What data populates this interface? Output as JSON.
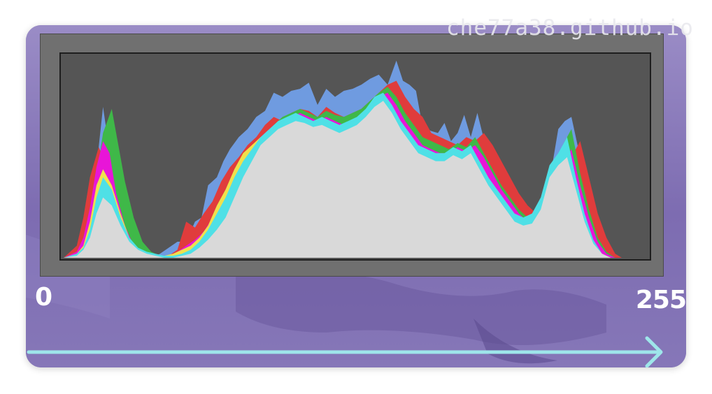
{
  "watermark": "che77a38.github.io",
  "axis": {
    "min_label": "0",
    "max_label": "255"
  },
  "colors": {
    "card_background": "#8272b4",
    "frame": "#707070",
    "plot_background": "#555555",
    "arrow": "#9ee6ea"
  },
  "chart_data": {
    "type": "area",
    "title": "",
    "xlabel": "",
    "ylabel": "",
    "xlim": [
      0,
      255
    ],
    "ylim": [
      0,
      100
    ],
    "grid": false,
    "legend": "none",
    "series": [
      {
        "color": "#6f9be0",
        "x": [
          0,
          6,
          9,
          13,
          16,
          18,
          20,
          22,
          24,
          27,
          30,
          33,
          36,
          40,
          44,
          48,
          52,
          56,
          60,
          63,
          66,
          70,
          73,
          76,
          80,
          84,
          88,
          92,
          96,
          100,
          104,
          108,
          112,
          116,
          120,
          124,
          128,
          132,
          136,
          140,
          144,
          148,
          152,
          155,
          158,
          161,
          164,
          168,
          171,
          174,
          177,
          180,
          183,
          186,
          189,
          192,
          195,
          198,
          202,
          206,
          210,
          214,
          218,
          222,
          226,
          229,
          232,
          235,
          238,
          241,
          244,
          247,
          250,
          253,
          255
        ],
        "y": [
          0,
          2,
          4,
          24,
          55,
          75,
          60,
          40,
          25,
          13,
          6,
          2,
          1,
          0,
          2,
          5,
          8,
          8,
          18,
          20,
          36,
          40,
          48,
          54,
          60,
          64,
          70,
          73,
          82,
          80,
          83,
          84,
          87,
          76,
          84,
          80,
          83,
          84,
          86,
          89,
          91,
          86,
          98,
          88,
          86,
          83,
          65,
          63,
          62,
          67,
          58,
          62,
          71,
          60,
          72,
          59,
          49,
          36,
          30,
          25,
          22,
          20,
          28,
          38,
          64,
          68,
          70,
          55,
          35,
          23,
          18,
          10,
          3,
          0,
          0
        ]
      },
      {
        "color": "#e03c3c",
        "x": [
          0,
          6,
          9,
          12,
          16,
          20,
          24,
          28,
          32,
          36,
          40,
          44,
          48,
          52,
          56,
          60,
          64,
          68,
          72,
          76,
          80,
          84,
          88,
          92,
          96,
          100,
          104,
          108,
          112,
          116,
          120,
          124,
          128,
          132,
          136,
          140,
          144,
          148,
          152,
          156,
          160,
          164,
          168,
          172,
          176,
          180,
          184,
          188,
          192,
          196,
          200,
          204,
          208,
          212,
          216,
          220,
          224,
          228,
          232,
          236,
          240,
          244,
          248,
          252,
          255
        ],
        "y": [
          0,
          6,
          20,
          40,
          55,
          45,
          30,
          15,
          6,
          2,
          1,
          0,
          1,
          4,
          18,
          15,
          22,
          28,
          38,
          45,
          50,
          56,
          60,
          66,
          70,
          68,
          72,
          74,
          73,
          70,
          75,
          72,
          70,
          72,
          74,
          78,
          82,
          86,
          88,
          80,
          74,
          70,
          62,
          60,
          58,
          56,
          60,
          58,
          62,
          56,
          48,
          40,
          32,
          26,
          22,
          20,
          22,
          30,
          50,
          58,
          40,
          22,
          10,
          2,
          0
        ]
      },
      {
        "color": "#3fb848",
        "x": [
          0,
          6,
          9,
          12,
          15,
          18,
          22,
          25,
          28,
          32,
          36,
          40,
          44,
          48,
          52,
          56,
          60,
          64,
          68,
          72,
          76,
          80,
          84,
          88,
          92,
          96,
          100,
          104,
          108,
          112,
          116,
          120,
          124,
          128,
          132,
          136,
          140,
          144,
          148,
          152,
          156,
          160,
          164,
          168,
          172,
          176,
          180,
          184,
          188,
          192,
          196,
          200,
          204,
          208,
          212,
          216,
          220,
          224,
          228,
          232,
          236,
          240,
          244,
          248,
          252,
          255
        ],
        "y": [
          0,
          3,
          8,
          20,
          40,
          62,
          74,
          56,
          38,
          20,
          8,
          3,
          1,
          0,
          1,
          3,
          6,
          10,
          14,
          22,
          30,
          40,
          48,
          56,
          62,
          66,
          70,
          72,
          74,
          72,
          70,
          73,
          71,
          70,
          72,
          74,
          78,
          82,
          85,
          80,
          72,
          66,
          60,
          58,
          56,
          54,
          57,
          55,
          60,
          52,
          44,
          36,
          30,
          24,
          20,
          18,
          20,
          30,
          56,
          64,
          42,
          24,
          10,
          3,
          0,
          0
        ]
      },
      {
        "color": "#e815d8",
        "x": [
          0,
          6,
          9,
          12,
          15,
          18,
          21,
          24,
          28,
          32,
          36,
          40,
          44,
          48,
          52,
          56,
          60,
          64,
          68,
          72,
          76,
          80,
          84,
          88,
          92,
          96,
          100,
          104,
          108,
          112,
          116,
          120,
          124,
          128,
          132,
          136,
          140,
          144,
          148,
          152,
          156,
          160,
          164,
          168,
          172,
          176,
          180,
          184,
          188,
          192,
          196,
          200,
          204,
          208,
          212,
          216,
          220,
          224,
          228,
          232,
          236,
          240,
          244,
          248,
          252,
          255
        ],
        "y": [
          0,
          3,
          10,
          25,
          45,
          58,
          52,
          32,
          16,
          6,
          2,
          1,
          0,
          1,
          3,
          6,
          9,
          13,
          20,
          28,
          36,
          44,
          52,
          58,
          62,
          66,
          68,
          70,
          72,
          70,
          68,
          70,
          68,
          66,
          68,
          70,
          74,
          80,
          82,
          76,
          68,
          62,
          56,
          54,
          52,
          52,
          55,
          53,
          56,
          50,
          42,
          34,
          28,
          22,
          18,
          16,
          18,
          26,
          46,
          54,
          36,
          20,
          8,
          2,
          0,
          0
        ]
      },
      {
        "color": "#f0e04c",
        "x": [
          0,
          6,
          9,
          12,
          15,
          18,
          22,
          26,
          30,
          34,
          38,
          42,
          46,
          50,
          54,
          58,
          62,
          66,
          70,
          74,
          78,
          82,
          86,
          90,
          94,
          98,
          102,
          106,
          110,
          114,
          118,
          122,
          126,
          130,
          134,
          138,
          142,
          146,
          150,
          154,
          158,
          162,
          166,
          170,
          174,
          178,
          182,
          186,
          190,
          194,
          198,
          202,
          206,
          210,
          214,
          218,
          222,
          226,
          230,
          234,
          238,
          242,
          246,
          250,
          255
        ],
        "y": [
          0,
          2,
          6,
          18,
          36,
          44,
          36,
          22,
          10,
          4,
          1,
          0,
          1,
          2,
          4,
          6,
          10,
          16,
          26,
          34,
          44,
          52,
          56,
          60,
          62,
          64,
          66,
          68,
          67,
          66,
          68,
          66,
          64,
          66,
          68,
          72,
          78,
          80,
          74,
          66,
          60,
          54,
          52,
          50,
          50,
          53,
          51,
          54,
          48,
          40,
          32,
          26,
          20,
          16,
          14,
          16,
          24,
          44,
          50,
          34,
          18,
          7,
          2,
          0,
          0
        ]
      },
      {
        "color": "#4fe0e6",
        "x": [
          0,
          6,
          9,
          12,
          15,
          18,
          22,
          26,
          30,
          34,
          38,
          42,
          46,
          50,
          54,
          58,
          62,
          66,
          70,
          74,
          78,
          82,
          86,
          90,
          94,
          98,
          102,
          106,
          110,
          114,
          118,
          122,
          126,
          130,
          134,
          138,
          142,
          146,
          150,
          154,
          158,
          162,
          166,
          170,
          174,
          178,
          182,
          186,
          190,
          194,
          198,
          202,
          206,
          210,
          214,
          218,
          222,
          226,
          230,
          234,
          238,
          242,
          246,
          250,
          255
        ],
        "y": [
          0,
          2,
          5,
          14,
          30,
          40,
          34,
          20,
          10,
          5,
          3,
          2,
          1,
          1,
          2,
          4,
          8,
          14,
          22,
          30,
          40,
          48,
          54,
          60,
          64,
          68,
          70,
          72,
          70,
          68,
          70,
          68,
          66,
          68,
          70,
          74,
          80,
          82,
          76,
          68,
          62,
          56,
          54,
          52,
          52,
          55,
          53,
          56,
          48,
          40,
          34,
          28,
          22,
          20,
          22,
          30,
          46,
          52,
          60,
          40,
          22,
          9,
          2,
          0,
          0
        ]
      },
      {
        "color": "#d9d9d9",
        "x": [
          0,
          6,
          9,
          12,
          15,
          18,
          22,
          26,
          30,
          34,
          38,
          42,
          46,
          50,
          54,
          58,
          62,
          66,
          70,
          74,
          78,
          82,
          86,
          90,
          94,
          98,
          102,
          106,
          110,
          114,
          118,
          122,
          126,
          130,
          134,
          138,
          142,
          146,
          150,
          154,
          158,
          162,
          166,
          170,
          174,
          178,
          182,
          186,
          190,
          194,
          198,
          202,
          206,
          210,
          214,
          218,
          222,
          226,
          230,
          234,
          238,
          242,
          246,
          250,
          255
        ],
        "y": [
          0,
          1,
          4,
          10,
          22,
          30,
          26,
          16,
          8,
          4,
          2,
          1,
          0,
          0,
          1,
          2,
          5,
          9,
          14,
          20,
          30,
          40,
          48,
          56,
          60,
          64,
          66,
          68,
          67,
          65,
          66,
          64,
          62,
          64,
          66,
          70,
          75,
          78,
          72,
          64,
          58,
          52,
          50,
          48,
          48,
          51,
          49,
          52,
          44,
          36,
          30,
          24,
          18,
          16,
          17,
          24,
          40,
          46,
          50,
          34,
          18,
          7,
          2,
          0,
          0
        ]
      }
    ]
  }
}
